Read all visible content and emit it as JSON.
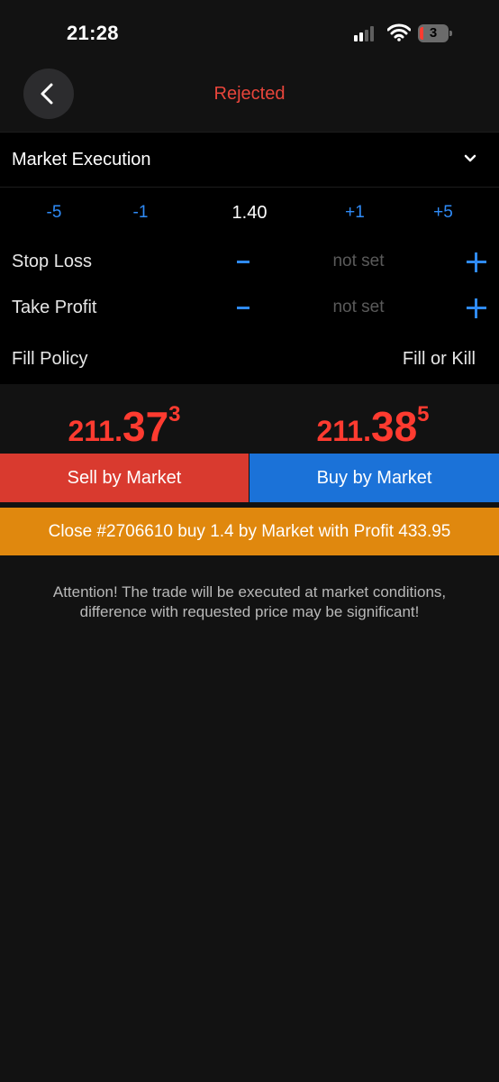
{
  "status": {
    "time": "21:28",
    "battery_level": "3",
    "icons": [
      "signal-icon",
      "wifi-icon",
      "battery-icon"
    ]
  },
  "nav": {
    "title": "Rejected",
    "back_icon": "chevron-left-icon"
  },
  "execution": {
    "label": "Market Execution",
    "chevron_icon": "chevron-down-icon"
  },
  "volume": {
    "steps_minus": [
      "-5",
      "-1"
    ],
    "value": "1.40",
    "steps_plus": [
      "+1",
      "+5"
    ]
  },
  "stop_loss": {
    "label": "Stop Loss",
    "value": "not set"
  },
  "take_profit": {
    "label": "Take Profit",
    "value": "not set"
  },
  "fill_policy": {
    "label": "Fill Policy",
    "value": "Fill or Kill"
  },
  "quotes": {
    "sell": {
      "base": "211.",
      "big": "37",
      "sup": "3"
    },
    "buy": {
      "base": "211.",
      "big": "38",
      "sup": "5"
    }
  },
  "buttons": {
    "sell": "Sell by Market",
    "buy": "Buy by Market",
    "close": "Close #2706610 buy 1.4 by Market with Profit 433.95"
  },
  "attention": "Attention! The trade will be executed at market conditions, difference with requested price may be significant!",
  "colors": {
    "accent_red": "#ff3b30",
    "sell": "#d93a2f",
    "buy": "#1b72d8",
    "close": "#e0880e",
    "link_blue": "#2f8bf7"
  }
}
